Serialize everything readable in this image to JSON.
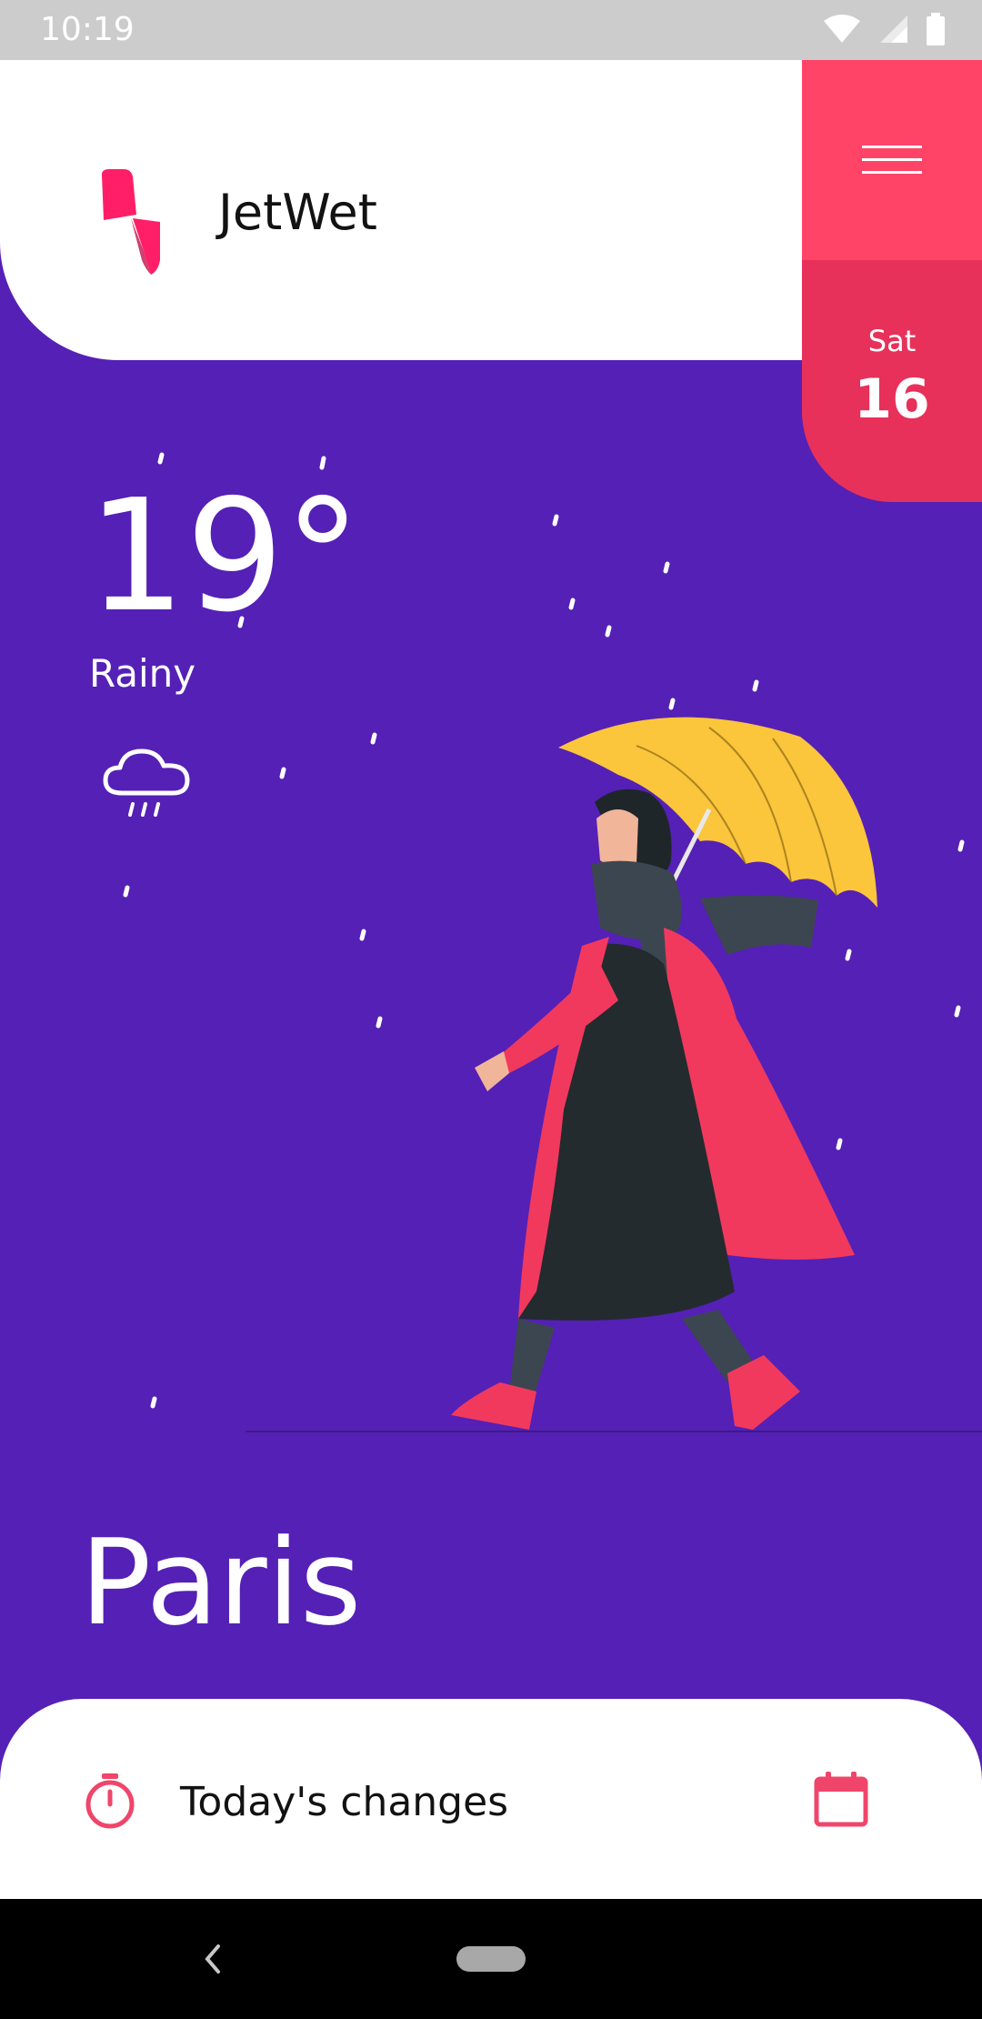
{
  "status_bar": {
    "time": "10:19"
  },
  "header": {
    "app_title": "JetWet",
    "date_day": "Sat",
    "date_number": "16"
  },
  "weather": {
    "temperature": "19°",
    "condition": "Rainy",
    "condition_icon": "cloud-rain-icon"
  },
  "location": {
    "city": "Paris"
  },
  "changes_panel": {
    "label": "Today's changes",
    "leading_icon": "timer-icon",
    "trailing_icon": "calendar-icon"
  },
  "colors": {
    "background_purple": "#5520b6",
    "accent_pink": "#ff4468",
    "accent_pink_dark": "#e7315a",
    "umbrella_yellow": "#fbc53c"
  }
}
